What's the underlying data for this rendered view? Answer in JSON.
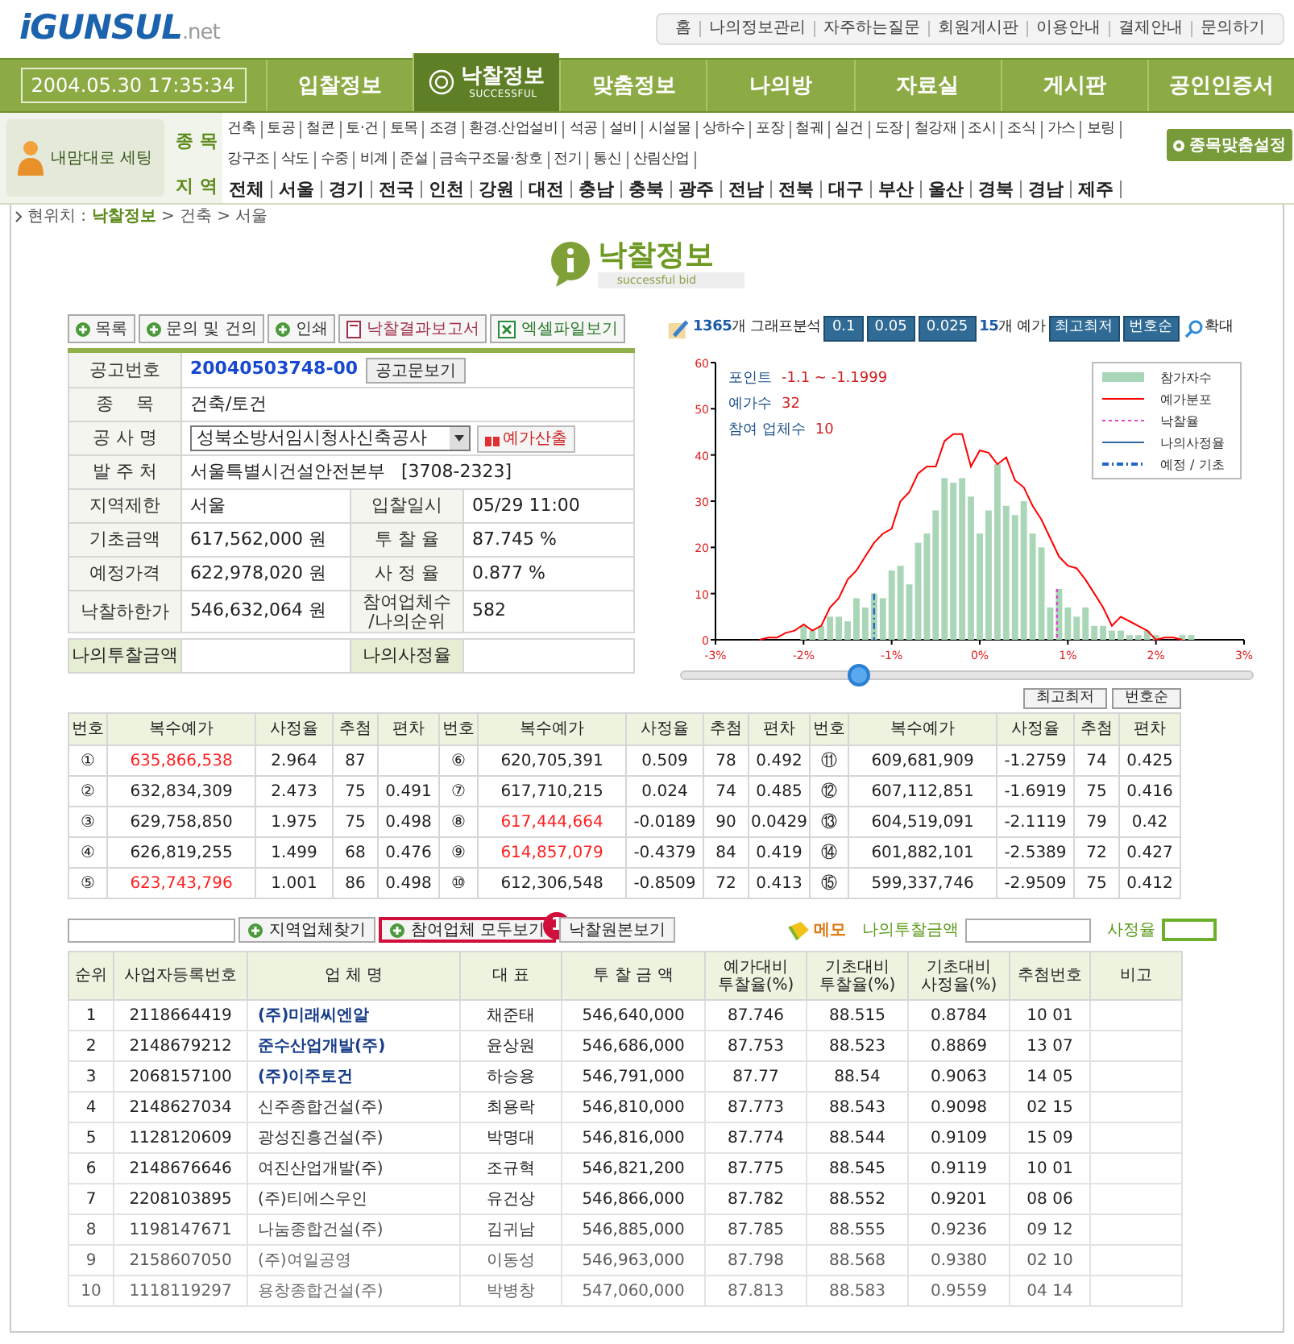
{
  "header": {
    "logo": {
      "main": "iGUNSUL",
      "suffix": ".net"
    },
    "top_links": [
      "홈",
      "나의정보관리",
      "자주하는질문",
      "회원게시판",
      "이용안내",
      "결제안내",
      "문의하기"
    ]
  },
  "nav": {
    "datetime": "2004.05.30 17:35:34",
    "tabs": [
      {
        "label": "입찰정보",
        "selected": false
      },
      {
        "label": "낙찰정보",
        "sublabel": "SUCCESSFUL",
        "selected": true
      },
      {
        "label": "맞춤정보",
        "selected": false
      },
      {
        "label": "나의방",
        "selected": false
      },
      {
        "label": "자료실",
        "selected": false
      },
      {
        "label": "게시판",
        "selected": false
      },
      {
        "label": "공인인증서",
        "selected": false
      }
    ]
  },
  "custom_setting": {
    "label": "내맘대로 세팅",
    "button": "종목맞춤설정",
    "categories": {
      "label": "종 목",
      "items": [
        "건축",
        "토공",
        "철콘",
        "토·건",
        "토목",
        "조경",
        "환경.산업설비",
        "석공",
        "설비",
        "시설물",
        "상하수",
        "포장",
        "철궤",
        "실건",
        "도장",
        "철강재",
        "조시",
        "조식",
        "가스",
        "보링",
        "강구조",
        "삭도",
        "수중",
        "비계",
        "준설",
        "금속구조물·창호",
        "전기",
        "통신",
        "산림산업"
      ]
    },
    "regions": {
      "label": "지 역",
      "items": [
        "전체",
        "서울",
        "경기",
        "전국",
        "인천",
        "강원",
        "대전",
        "충남",
        "충북",
        "광주",
        "전남",
        "전북",
        "대구",
        "부산",
        "울산",
        "경북",
        "경남",
        "제주"
      ]
    }
  },
  "breadcrumb": {
    "label": "현위치 :",
    "current": "낙찰정보",
    "rest": "> 건축 > 서울"
  },
  "page_title": {
    "title": "낙찰정보",
    "subtitle": "successful bid"
  },
  "actions": [
    {
      "label": "목록",
      "kind": "plus"
    },
    {
      "label": "문의 및 건의",
      "kind": "plus"
    },
    {
      "label": "인쇄",
      "kind": "plus"
    },
    {
      "label": "낙찰결과보고서",
      "kind": "report"
    },
    {
      "label": "엑셀파일보기",
      "kind": "excel"
    }
  ],
  "info": [
    {
      "kind": "notice",
      "label": "공고번호",
      "value": "20040503748-00",
      "button": "공고문보기"
    },
    {
      "kind": "text",
      "label": "종    목",
      "value": "건축/토건"
    },
    {
      "kind": "select",
      "label": "공 사 명",
      "value": "성북소방서임시청사신축공사",
      "button": "예가산출"
    },
    {
      "kind": "text",
      "label": "발 주 처",
      "value": "서울특별시건설안전본부",
      "extra": "[3708-2323]"
    },
    {
      "kind": "pair",
      "label": "지역제한",
      "value": "서울",
      "label2": "입찰일시",
      "value2": "05/29 11:00"
    },
    {
      "kind": "pair",
      "label": "기초금액",
      "value": "617,562,000 원",
      "label2": "투 찰 율",
      "value2": "87.745 %"
    },
    {
      "kind": "pair",
      "label": "예정가격",
      "value": "622,978,020 원",
      "label2": "사 정 율",
      "value2": "0.877 %"
    },
    {
      "kind": "pair",
      "label": "낙찰하한가",
      "value": "546,632,064 원",
      "label2": "참여업체수\n/나의순위",
      "value2": "582"
    }
  ],
  "my_bid": {
    "label": "나의투찰금액",
    "label2": "나의사정율"
  },
  "chart": {
    "count": "1365",
    "count_label": "개 그래프분석",
    "steps": [
      "0.1",
      "0.05",
      "0.025"
    ],
    "prices": "15",
    "prices_label": "개 예가",
    "sort_buttons": [
      "최고최저",
      "번호순"
    ],
    "zoom": "확대",
    "info": [
      {
        "label": "포인트",
        "value": "-1.1 ~ -1.1999"
      },
      {
        "label": "예가수",
        "value": "32"
      },
      {
        "label": "참여 업체수",
        "value": "10"
      }
    ],
    "slider": {
      "level": 0.31
    },
    "chart_data": {
      "type": "bar",
      "x": [
        -2.5,
        -2.4,
        -2.3,
        -2.2,
        -2.1,
        -2.0,
        -1.9,
        -1.8,
        -1.7,
        -1.6,
        -1.5,
        -1.4,
        -1.3,
        -1.2,
        -1.1,
        -1.0,
        -0.9,
        -0.8,
        -0.7,
        -0.6,
        -0.5,
        -0.4,
        -0.3,
        -0.2,
        -0.1,
        0.0,
        0.1,
        0.2,
        0.3,
        0.4,
        0.5,
        0.6,
        0.7,
        0.8,
        0.9,
        1.0,
        1.1,
        1.2,
        1.3,
        1.4,
        1.5,
        1.6,
        1.7,
        1.8,
        1.9,
        2.0,
        2.1,
        2.2,
        2.3,
        2.4
      ],
      "series": [
        {
          "name": "참가자수",
          "color": "#a9d6b6",
          "values": [
            null,
            null,
            null,
            null,
            null,
            3,
            2,
            3,
            5,
            5,
            4,
            9,
            7,
            10,
            9,
            15,
            16,
            12,
            21,
            23,
            28,
            35,
            34,
            35,
            31,
            23,
            28,
            38,
            29,
            27,
            30,
            23,
            20,
            7,
            11,
            7,
            5,
            7,
            3,
            3,
            2,
            2,
            1,
            1,
            2,
            1,
            null,
            null,
            1,
            1
          ]
        },
        {
          "name": "예가분포",
          "type": "line",
          "color": "#ff0000",
          "values": [
            0,
            0.5,
            0.5,
            1.5,
            2,
            3.3,
            2,
            3,
            7,
            9,
            13,
            15,
            18,
            21,
            23,
            24,
            30,
            32,
            36,
            37.5,
            37.5,
            43,
            44.5,
            44.5,
            37.5,
            41,
            40.5,
            38,
            39.5,
            34.5,
            33,
            29,
            26,
            22,
            18,
            16,
            15.5,
            13,
            10,
            7,
            3,
            5,
            4,
            3,
            2,
            0,
            0.5,
            0.5,
            0,
            null
          ]
        },
        {
          "name": "나의사정율",
          "type": "line",
          "color": "#336699",
          "values": [
            null,
            null,
            null,
            null,
            null,
            null,
            null,
            null,
            null,
            null,
            null,
            null,
            null,
            null,
            null,
            null,
            null,
            null,
            null,
            null,
            null,
            null,
            null,
            null,
            null,
            null,
            null,
            null,
            null,
            null,
            null,
            null,
            null,
            null,
            null,
            null,
            null,
            null,
            null,
            null,
            null,
            null,
            null,
            null,
            null,
            null,
            null,
            null,
            null,
            null
          ]
        }
      ],
      "xlim": [
        -3,
        3
      ],
      "ylim": [
        0,
        60
      ],
      "xticks": [
        {
          "value": -3,
          "label": "-3%"
        },
        {
          "value": -2,
          "label": "-2%"
        },
        {
          "value": -1,
          "label": "-1%"
        },
        {
          "value": 0,
          "label": "0%"
        },
        {
          "value": 1,
          "label": "1%"
        },
        {
          "value": 2,
          "label": "2%"
        },
        {
          "value": 3,
          "label": "3%"
        }
      ],
      "yticks": [
        0,
        10,
        20,
        30,
        40,
        50,
        60
      ],
      "ref_lines": [
        {
          "axis": "x",
          "value": 0.877,
          "label": "낙찰율",
          "color": "#dd44cc"
        },
        {
          "axis": "x",
          "value": -1.2,
          "label": "예정 / 기초",
          "color": "#2266cc"
        }
      ],
      "legend": "upper right"
    }
  },
  "price_buttons": [
    "최고최저",
    "번호순"
  ],
  "price_table": {
    "columns": [
      "번호",
      "복수예가",
      "사정율",
      "추첨",
      "편차",
      "번호",
      "복수예가",
      "사정율",
      "추첨",
      "편차",
      "번호",
      "복수예가",
      "사정율",
      "추첨",
      "편차"
    ],
    "entries": [
      {
        "no": "①",
        "price": "635,866,538",
        "rate": "2.964",
        "draws": "87",
        "highlighted": true
      },
      {
        "no": "②",
        "price": "632,834,309",
        "rate": "2.473",
        "draws": "75",
        "deviation": "0.491",
        "highlighted": false
      },
      {
        "no": "③",
        "price": "629,758,850",
        "rate": "1.975",
        "draws": "75",
        "deviation": "0.498",
        "highlighted": false
      },
      {
        "no": "④",
        "price": "626,819,255",
        "rate": "1.499",
        "draws": "68",
        "deviation": "0.476",
        "highlighted": false
      },
      {
        "no": "⑤",
        "price": "623,743,796",
        "rate": "1.001",
        "draws": "86",
        "deviation": "0.498",
        "highlighted": true
      },
      {
        "no": "⑥",
        "price": "620,705,391",
        "rate": "0.509",
        "draws": "78",
        "deviation": "0.492",
        "highlighted": false
      },
      {
        "no": "⑦",
        "price": "617,710,215",
        "rate": "0.024",
        "draws": "74",
        "deviation": "0.485",
        "highlighted": false
      },
      {
        "no": "⑧",
        "price": "617,444,664",
        "rate": "-0.0189",
        "draws": "90",
        "deviation": "0.0429",
        "highlighted": true
      },
      {
        "no": "⑨",
        "price": "614,857,079",
        "rate": "-0.4379",
        "draws": "84",
        "deviation": "0.419",
        "highlighted": true
      },
      {
        "no": "⑩",
        "price": "612,306,548",
        "rate": "-0.8509",
        "draws": "72",
        "deviation": "0.413",
        "highlighted": false
      },
      {
        "no": "⑪",
        "price": "609,681,909",
        "rate": "-1.2759",
        "draws": "74",
        "deviation": "0.425",
        "highlighted": false
      },
      {
        "no": "⑫",
        "price": "607,112,851",
        "rate": "-1.6919",
        "draws": "75",
        "deviation": "0.416",
        "highlighted": false
      },
      {
        "no": "⑬",
        "price": "604,519,091",
        "rate": "-2.1119",
        "draws": "79",
        "deviation": "0.42",
        "highlighted": false
      },
      {
        "no": "⑭",
        "price": "601,882,101",
        "rate": "-2.5389",
        "draws": "72",
        "deviation": "0.427",
        "highlighted": false
      },
      {
        "no": "⑮",
        "price": "599,337,746",
        "rate": "-2.9509",
        "draws": "75",
        "deviation": "0.412",
        "highlighted": false
      }
    ]
  },
  "bidder_toolbar": {
    "buttons": [
      {
        "label": "지역업체찾기",
        "highlighted": false
      },
      {
        "label": "참여업체 모두보기",
        "highlighted": true,
        "callout": "1"
      },
      {
        "label": "낙찰원본보기",
        "highlighted": false
      }
    ],
    "memo": "메모",
    "my_bid_label": "나의투찰금액",
    "rate_label": "사정율"
  },
  "bidders": {
    "columns": [
      "순위",
      "사업자등록번호",
      "업 체 명",
      "대 표",
      "투 찰 금 액",
      "예가대비\n투찰율(%)",
      "기초대비\n투찰율(%)",
      "기초대비\n사정율(%)",
      "추첨번호",
      "비고"
    ],
    "rows": [
      {
        "cells": [
          "1",
          "2118664419",
          "(주)미래씨엔알",
          "채준태",
          "546,640,000",
          "87.746",
          "88.515",
          "0.8784",
          "10 01"
        ],
        "linked": true
      },
      {
        "cells": [
          "2",
          "2148679212",
          "준수산업개발(주)",
          "윤상원",
          "546,686,000",
          "87.753",
          "88.523",
          "0.8869",
          "13 07"
        ],
        "linked": true
      },
      {
        "cells": [
          "3",
          "2068157100",
          "(주)이주토건",
          "하승용",
          "546,791,000",
          "87.77",
          "88.54",
          "0.9063",
          "14 05"
        ],
        "linked": true
      },
      {
        "cells": [
          "4",
          "2148627034",
          "신주종합건설(주)",
          "최용락",
          "546,810,000",
          "87.773",
          "88.543",
          "0.9098",
          "02 15"
        ],
        "linked": false
      },
      {
        "cells": [
          "5",
          "1128120609",
          "광성진흥건설(주)",
          "박명대",
          "546,816,000",
          "87.774",
          "88.544",
          "0.9109",
          "15 09"
        ],
        "linked": false
      },
      {
        "cells": [
          "6",
          "2148676646",
          "여진산업개발(주)",
          "조규혁",
          "546,821,200",
          "87.775",
          "88.545",
          "0.9119",
          "10 01"
        ],
        "linked": false
      },
      {
        "cells": [
          "7",
          "2208103895",
          "(주)티에스우인",
          "유건상",
          "546,866,000",
          "87.782",
          "88.552",
          "0.9201",
          "08 06"
        ],
        "linked": false
      },
      {
        "cells": [
          "8",
          "1198147671",
          "나눔종합건설(주)",
          "김귀남",
          "546,885,000",
          "87.785",
          "88.555",
          "0.9236",
          "09 12"
        ],
        "linked": false
      },
      {
        "cells": [
          "9",
          "2158607050",
          "(주)여일공영",
          "이동성",
          "546,963,000",
          "87.798",
          "88.568",
          "0.9380",
          "02 10"
        ],
        "linked": false
      },
      {
        "cells": [
          "10",
          "1118119297",
          "용창종합건설(주)",
          "박병창",
          "547,060,000",
          "87.813",
          "88.583",
          "0.9559",
          "04 14"
        ],
        "linked": false
      }
    ]
  }
}
